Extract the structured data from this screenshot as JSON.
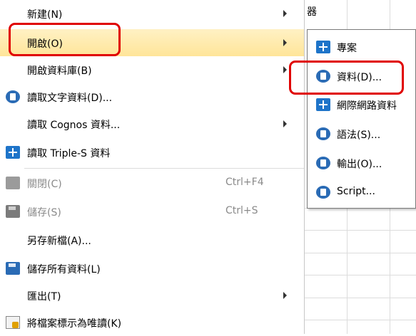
{
  "background": {
    "partial_text": "器"
  },
  "menu": {
    "items": [
      {
        "label": "新建(N)",
        "shortcut": "",
        "has_submenu": true,
        "icon": "",
        "disabled": false
      },
      {
        "label": "開啟(O)",
        "shortcut": "",
        "has_submenu": true,
        "icon": "",
        "disabled": false,
        "highlighted": true
      },
      {
        "label": "開啟資料庫(B)",
        "shortcut": "",
        "has_submenu": true,
        "icon": "",
        "disabled": false
      },
      {
        "label": "讀取文字資料(D)...",
        "shortcut": "",
        "has_submenu": false,
        "icon": "text-data-icon",
        "disabled": false
      },
      {
        "label": "讀取 Cognos 資料...",
        "shortcut": "",
        "has_submenu": true,
        "icon": "",
        "disabled": false
      },
      {
        "label": "讀取 Triple-S 資料",
        "shortcut": "",
        "has_submenu": false,
        "icon": "triple-s-icon",
        "disabled": false
      },
      {
        "label": "關閉(C)",
        "shortcut": "Ctrl+F4",
        "has_submenu": false,
        "icon": "close-file-icon",
        "disabled": true
      },
      {
        "label": "儲存(S)",
        "shortcut": "Ctrl+S",
        "has_submenu": false,
        "icon": "save-icon",
        "disabled": true
      },
      {
        "label": "另存新檔(A)...",
        "shortcut": "",
        "has_submenu": false,
        "icon": "",
        "disabled": false
      },
      {
        "label": "儲存所有資料(L)",
        "shortcut": "",
        "has_submenu": false,
        "icon": "save-all-icon",
        "disabled": false
      },
      {
        "label": "匯出(T)",
        "shortcut": "",
        "has_submenu": true,
        "icon": "",
        "disabled": false
      },
      {
        "label": "將檔案標示為唯讀(K)",
        "shortcut": "",
        "has_submenu": false,
        "icon": "read-only-icon",
        "disabled": false
      }
    ]
  },
  "submenu": {
    "items": [
      {
        "label": "專案",
        "icon": "project-icon"
      },
      {
        "label": "資料(D)...",
        "icon": "data-file-icon",
        "highlighted_box": true
      },
      {
        "label": "網際網路資料",
        "icon": "internet-data-icon"
      },
      {
        "label": "語法(S)...",
        "icon": "syntax-file-icon"
      },
      {
        "label": "輸出(O)...",
        "icon": "output-file-icon"
      },
      {
        "label": "Script...",
        "icon": "script-file-icon"
      }
    ]
  },
  "colors": {
    "highlight": "#ffe599",
    "annotation_red": "#e00000",
    "icon_blue": "#2a6bb5"
  }
}
